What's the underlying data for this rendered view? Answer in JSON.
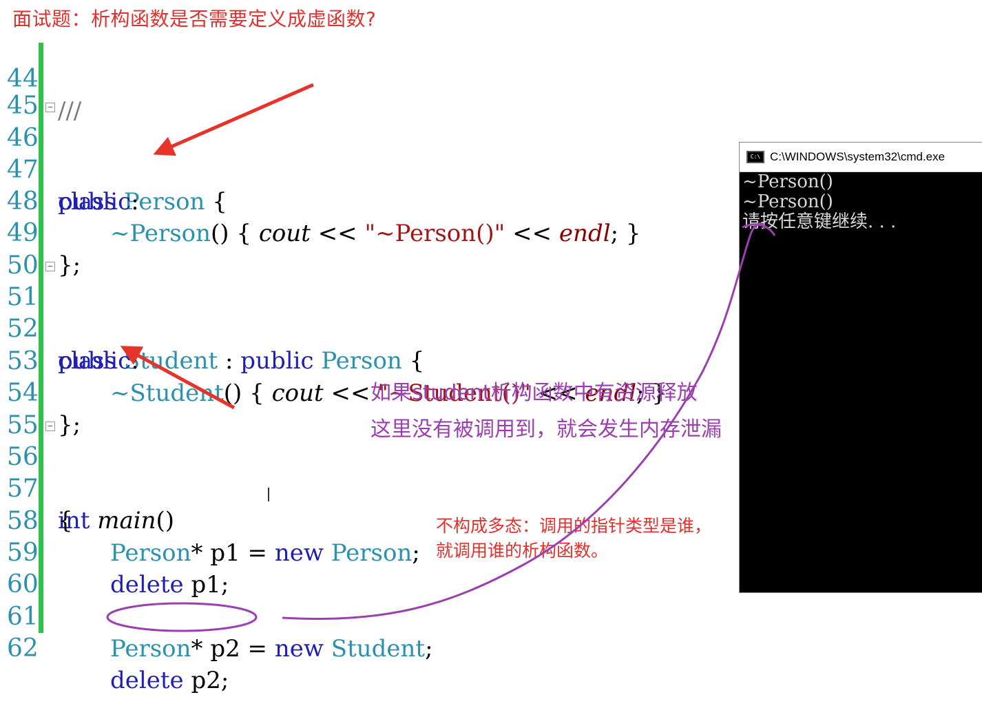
{
  "title": "面试题：析构函数是否需要定义成虚函数?",
  "editor": {
    "lines": [
      {
        "n": "44",
        "code": "///"
      },
      {
        "n": "45",
        "code": ""
      },
      {
        "n": "46",
        "code": "class Person {"
      },
      {
        "n": "47",
        "code": "public:"
      },
      {
        "n": "48",
        "code": "~Person() { cout << \"~Person()\" << endl; }"
      },
      {
        "n": "49",
        "code": "};"
      },
      {
        "n": "50",
        "code": ""
      },
      {
        "n": "51",
        "code": "class Student : public Person {"
      },
      {
        "n": "52",
        "code": "public:"
      },
      {
        "n": "53",
        "code": "~Student() { cout << \"~Student()\" << endl; }"
      },
      {
        "n": "54",
        "code": "};"
      },
      {
        "n": "55",
        "code": ""
      },
      {
        "n": "56",
        "code": "int main()"
      },
      {
        "n": "57",
        "code": "{"
      },
      {
        "n": "58",
        "code": "Person* p1 = new Person;"
      },
      {
        "n": "59",
        "code": "delete p1;"
      },
      {
        "n": "60",
        "code": ""
      },
      {
        "n": "61",
        "code": "Person* p2 = new Student;"
      },
      {
        "n": "62",
        "code": "delete p2;"
      }
    ]
  },
  "annotations": {
    "purple_line1": "如果student析构函数中有资源释放",
    "purple_line2": "这里没有被调用到，就会发生内存泄漏",
    "red_line1": "不构成多态：调用的指针类型是谁，",
    "red_line2": "就调用谁的析构函数。"
  },
  "console": {
    "title": "C:\\WINDOWS\\system32\\cmd.exe",
    "icon": "cmd-icon",
    "output": [
      "~Person()",
      "~Person()",
      "请按任意键继续. . ."
    ]
  },
  "colors": {
    "title": "#e0312d",
    "keyword": "#1f1fb3",
    "type": "#2b91af",
    "string": "#a31515",
    "line_number": "#2b91af",
    "change_bar": "#2ec24a",
    "purple_annotation": "#9b3fb0",
    "red_annotation": "#e0312d",
    "arrow": "#e8332b"
  }
}
